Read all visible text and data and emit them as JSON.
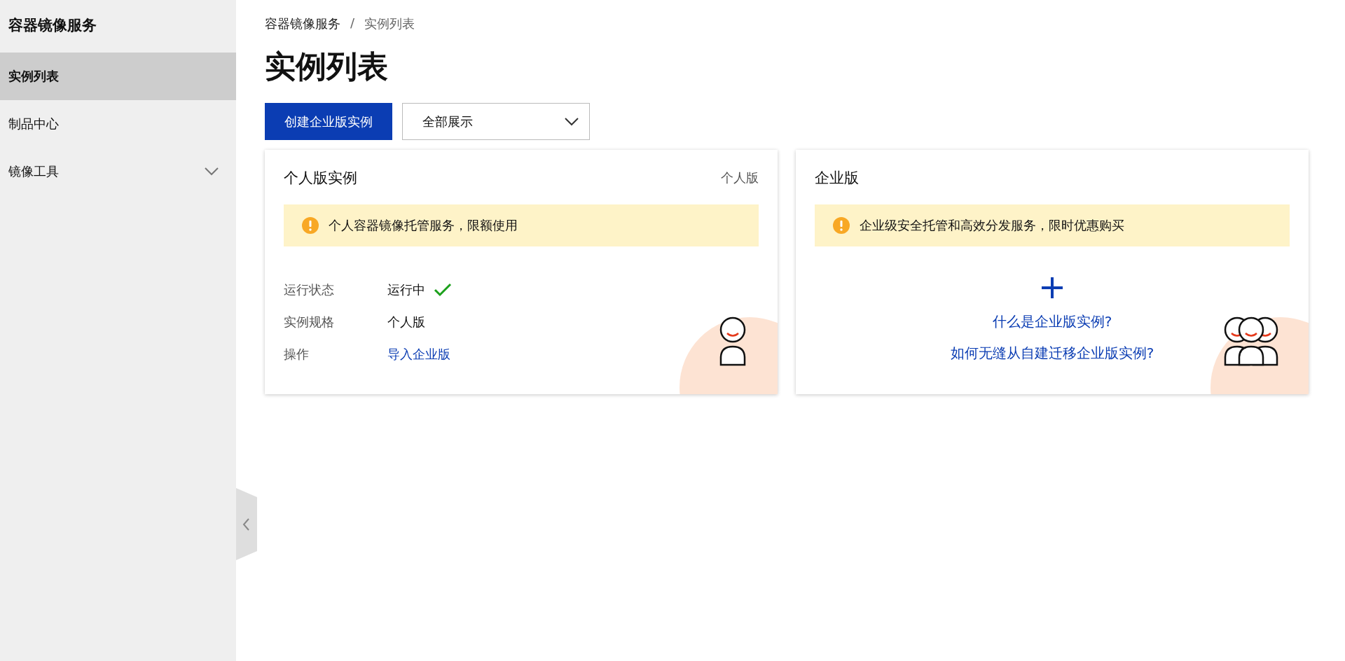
{
  "sidebar": {
    "title": "容器镜像服务",
    "items": [
      {
        "label": "实例列表",
        "kind": "link",
        "selected": true
      },
      {
        "label": "制品中心",
        "kind": "link",
        "selected": false
      },
      {
        "label": "镜像工具",
        "kind": "group",
        "selected": false,
        "expanded": false
      }
    ]
  },
  "breadcrumb": [
    "容器镜像服务",
    "实例列表"
  ],
  "breadcrumb_separator": "/",
  "page_title": "实例列表",
  "toolbar": {
    "create_button": "创建企业版实例",
    "filter": {
      "value": "全部展示"
    }
  },
  "cards": [
    {
      "kind": "instance",
      "title": "个人版实例",
      "tag": "个人版",
      "alert": "个人容器镜像托管服务，限额使用",
      "fields": [
        {
          "label": "运行状态",
          "value": "运行中",
          "kind": "status",
          "running": true
        },
        {
          "label": "实例规格",
          "value": "个人版",
          "kind": "text"
        },
        {
          "label": "操作",
          "value": "导入企业版",
          "kind": "link"
        }
      ]
    },
    {
      "kind": "empty",
      "title": "企业版",
      "alert": "企业级安全托管和高效分发服务，限时优惠购买",
      "links": [
        "什么是企业版实例?",
        "如何无缝从自建迁移企业版实例?"
      ]
    }
  ]
}
